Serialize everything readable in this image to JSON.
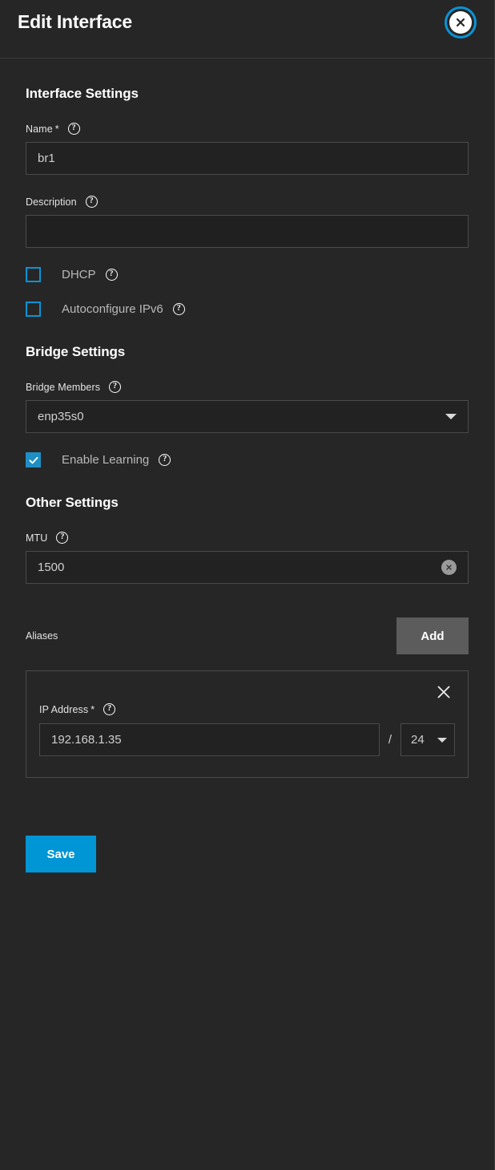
{
  "header": {
    "title": "Edit Interface",
    "close_label": "close-icon"
  },
  "sections": {
    "interface": {
      "title": "Interface Settings",
      "name": {
        "label": "Name",
        "required_marker": "*",
        "value": "br1",
        "placeholder": ""
      },
      "description": {
        "label": "Description",
        "value": "",
        "placeholder": ""
      },
      "dhcp": {
        "label": "DHCP",
        "checked": false
      },
      "autoconfigure_ipv6": {
        "label": "Autoconfigure IPv6",
        "checked": false
      }
    },
    "bridge": {
      "title": "Bridge Settings",
      "bridge_members": {
        "label": "Bridge Members",
        "value": "enp35s0"
      },
      "enable_learning": {
        "label": "Enable Learning",
        "checked": true
      }
    },
    "other": {
      "title": "Other Settings",
      "mtu": {
        "label": "MTU",
        "value": "1500",
        "clear_label": "clear-icon"
      },
      "aliases": {
        "label": "Aliases",
        "add_label": "Add",
        "entries": [
          {
            "ip_label": "IP Address",
            "required_marker": "*",
            "ip_value": "192.168.1.35",
            "separator": "/",
            "netmask": "24"
          }
        ]
      }
    }
  },
  "footer": {
    "save_label": "Save"
  },
  "icons": {
    "help": "?"
  },
  "colors": {
    "accent": "#0095d5",
    "checkbox_border": "#0b93d5",
    "checkbox_fill": "#1f8ec4",
    "background": "#262626",
    "input_background": "#222222",
    "input_border": "#4a4a4a",
    "add_button": "#5c5c5c"
  }
}
